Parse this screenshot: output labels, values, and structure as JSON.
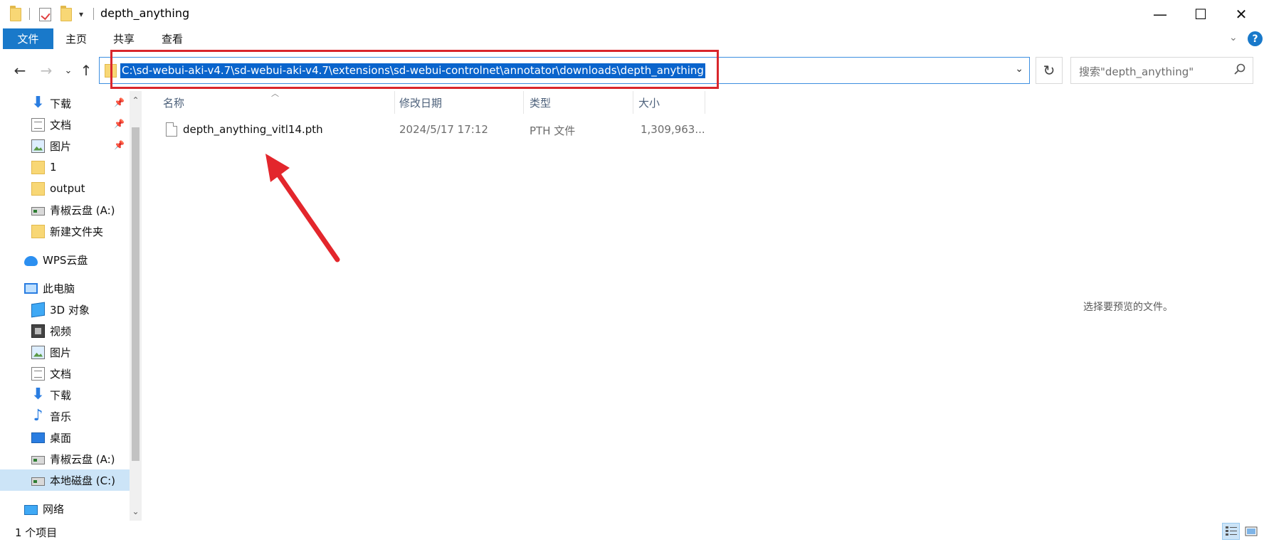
{
  "window": {
    "title": "depth_anything",
    "minimize": "—",
    "maximize": "☐",
    "close": "✕"
  },
  "ribbon": {
    "tabs": [
      "文件",
      "主页",
      "共享",
      "查看"
    ],
    "collapse": "⌄",
    "help": "?"
  },
  "address": {
    "path": "C:\\sd-webui-aki-v4.7\\sd-webui-aki-v4.7\\extensions\\sd-webui-controlnet\\annotator\\downloads\\depth_anything",
    "dropdown": "⌄",
    "refresh": "↻"
  },
  "nav_buttons": {
    "back": "←",
    "forward": "→",
    "recent": "⌄",
    "up": "↑"
  },
  "search": {
    "placeholder": "搜索\"depth_anything\""
  },
  "sidebar": {
    "items": [
      {
        "label": "下载",
        "icon": "download-icon",
        "pinned": true
      },
      {
        "label": "文档",
        "icon": "document-icon",
        "pinned": true
      },
      {
        "label": "图片",
        "icon": "picture-icon",
        "pinned": true
      },
      {
        "label": "1",
        "icon": "folder-icon"
      },
      {
        "label": "output",
        "icon": "folder-icon"
      },
      {
        "label": "青椒云盘 (A:)",
        "icon": "drive-icon"
      },
      {
        "label": "新建文件夹",
        "icon": "folder-icon"
      },
      {
        "label": "WPS云盘",
        "icon": "cloud-icon"
      },
      {
        "label": "此电脑",
        "icon": "computer-icon"
      },
      {
        "label": "3D 对象",
        "icon": "3d-objects-icon"
      },
      {
        "label": "视频",
        "icon": "video-icon"
      },
      {
        "label": "图片",
        "icon": "picture-icon"
      },
      {
        "label": "文档",
        "icon": "document-icon"
      },
      {
        "label": "下载",
        "icon": "download-icon"
      },
      {
        "label": "音乐",
        "icon": "music-icon"
      },
      {
        "label": "桌面",
        "icon": "desktop-icon"
      },
      {
        "label": "青椒云盘 (A:)",
        "icon": "drive-icon"
      },
      {
        "label": "本地磁盘 (C:)",
        "icon": "local-disk-icon",
        "selected": true
      },
      {
        "label": "网络",
        "icon": "network-icon"
      }
    ]
  },
  "columns": [
    "名称",
    "修改日期",
    "类型",
    "大小"
  ],
  "files": [
    {
      "name": "depth_anything_vitl14.pth",
      "modified": "2024/5/17 17:12",
      "type": "PTH 文件",
      "size": "1,309,963..."
    }
  ],
  "preview_text": "选择要预览的文件。",
  "status": {
    "item_count": "1 个项目"
  },
  "annotation_color": "#d9262c",
  "accent_color": "#1979ca"
}
